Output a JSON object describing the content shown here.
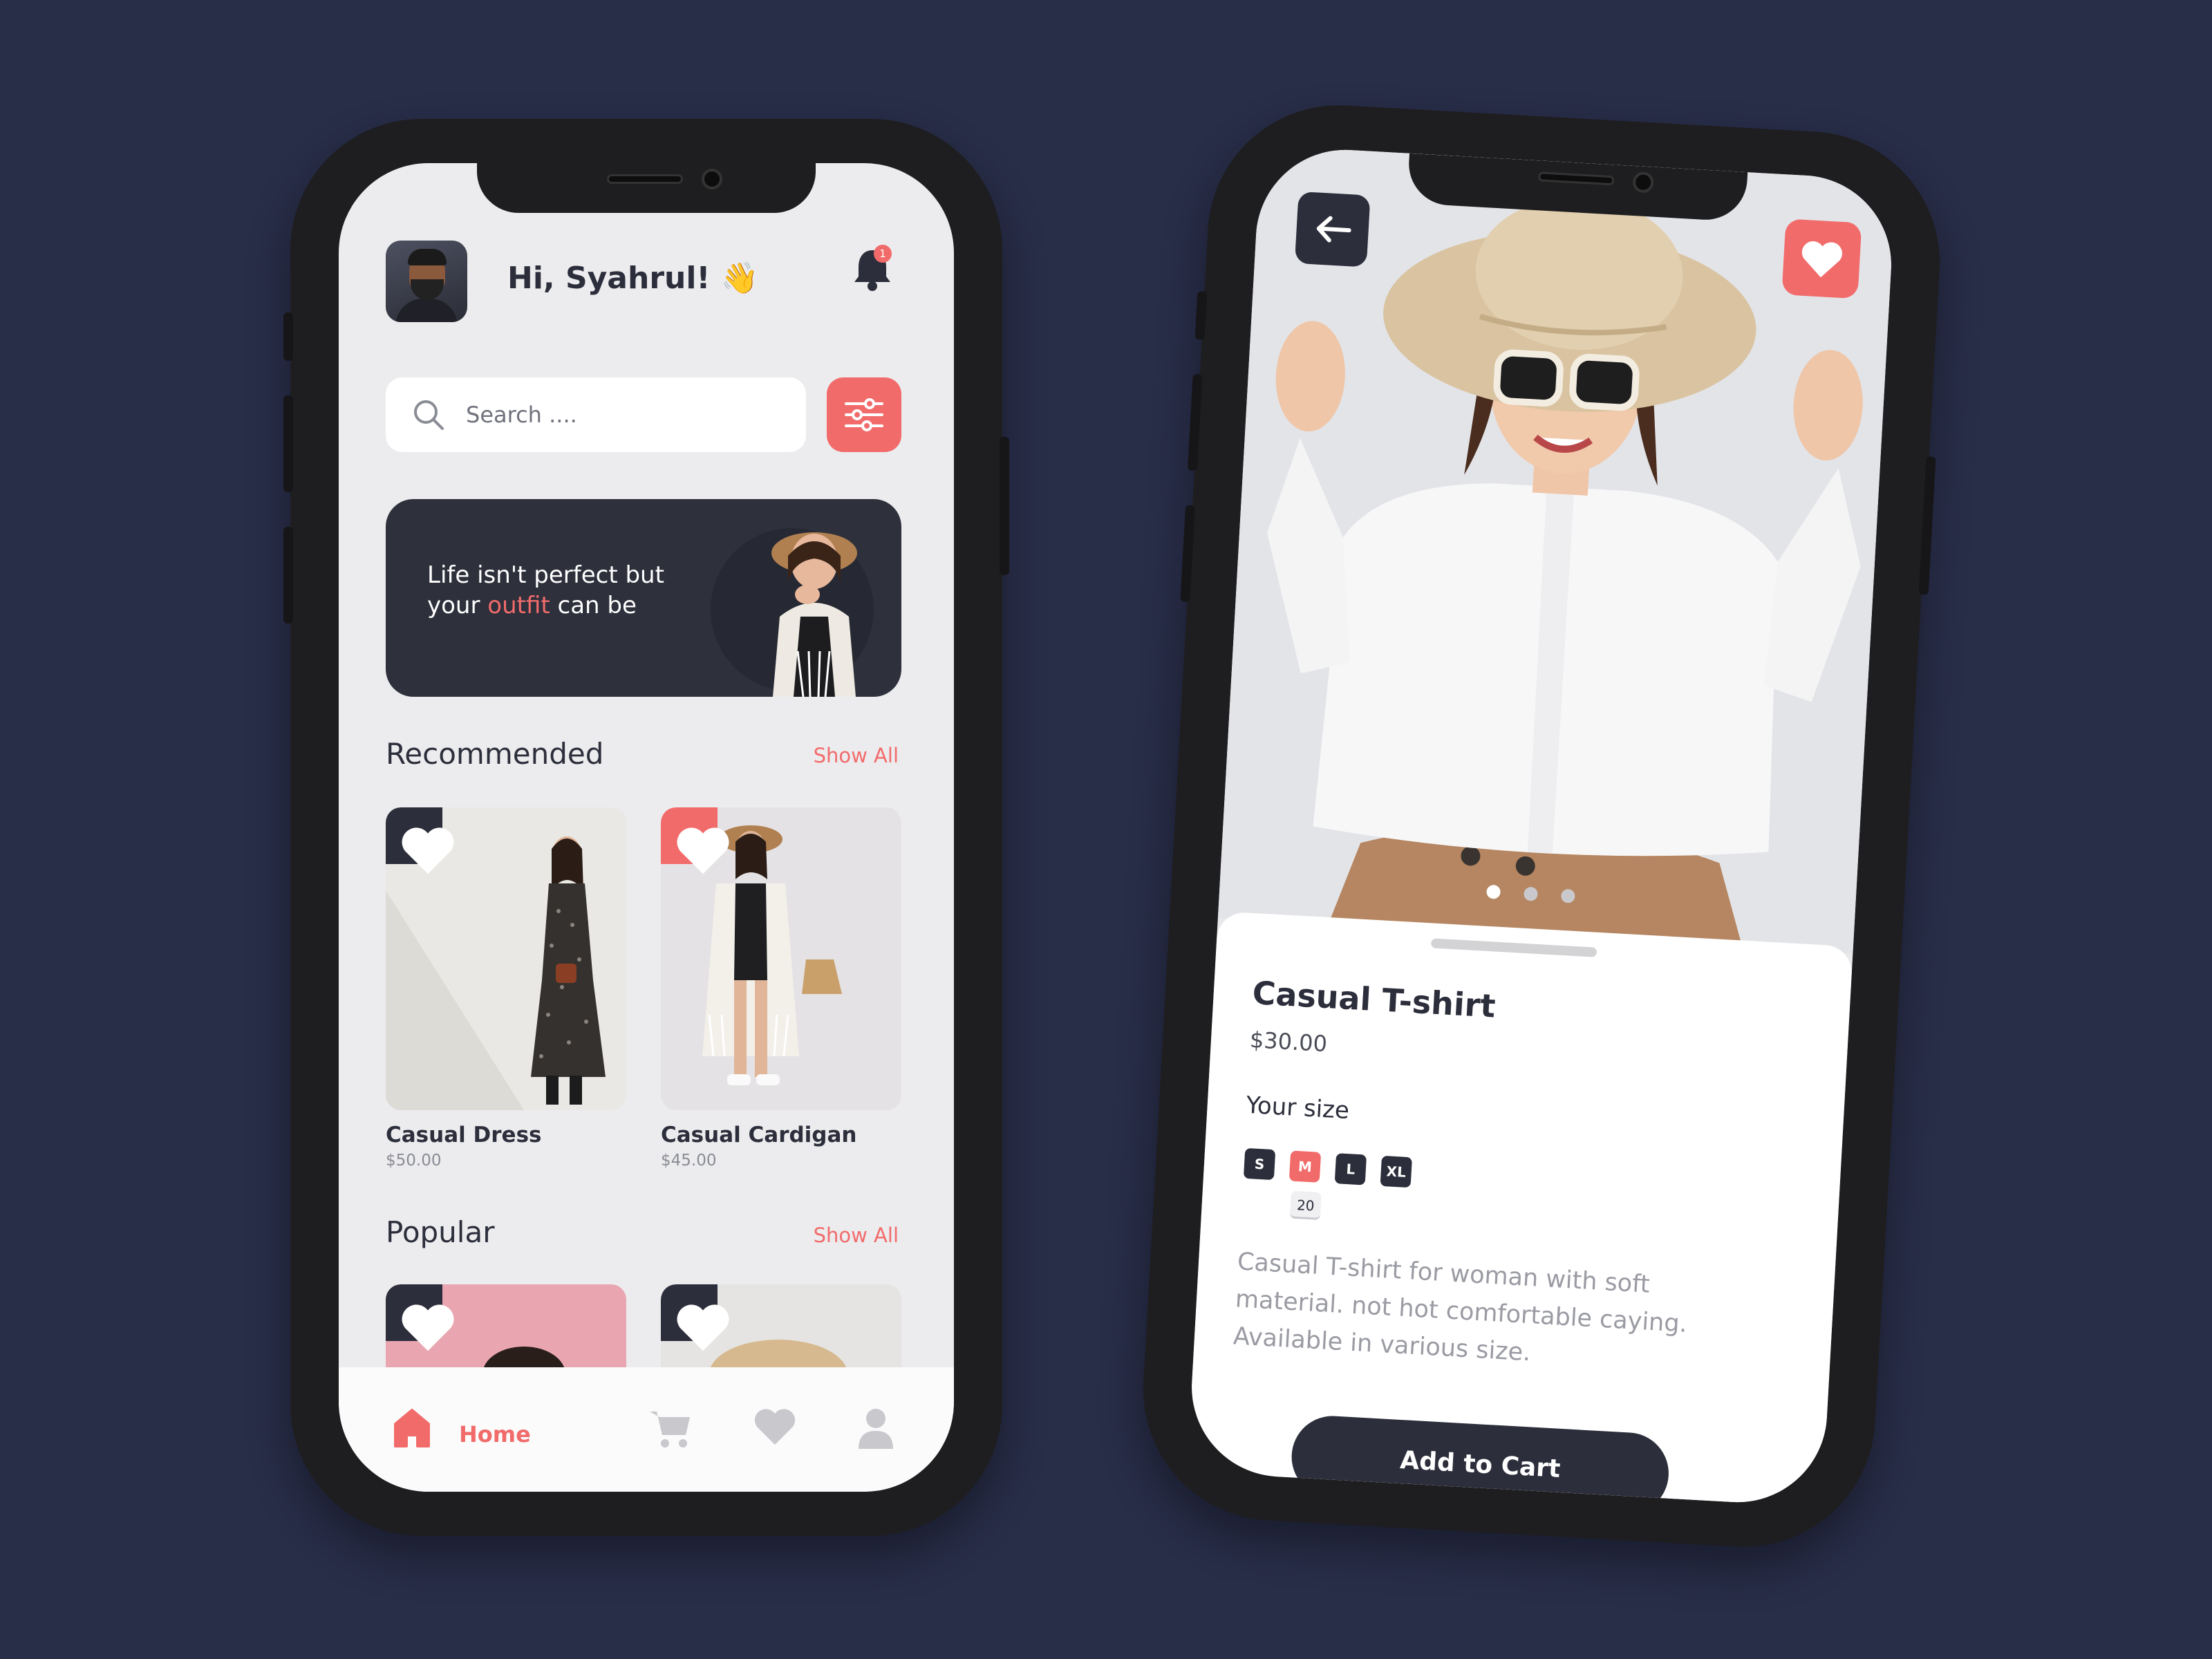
{
  "home": {
    "greeting": "Hi, Syahrul! 👋",
    "notification_count": "1",
    "search": {
      "placeholder": "Search ...."
    },
    "banner": {
      "line1": "Life isn't perfect but",
      "line2_prefix": "your ",
      "line2_accent": "outfit",
      "line2_suffix": " can be"
    },
    "recommended": {
      "title": "Recommended",
      "show_all": "Show All",
      "items": [
        {
          "name": "Casual Dress",
          "price": "$50.00",
          "favorited": false
        },
        {
          "name": "Casual  Cardigan",
          "price": "$45.00",
          "favorited": true
        }
      ]
    },
    "popular": {
      "title": "Popular",
      "show_all": "Show All"
    },
    "tabbar": {
      "active_label": "Home",
      "tabs": [
        "home-icon",
        "cart-icon",
        "heart-icon",
        "profile-icon"
      ]
    }
  },
  "detail": {
    "title": "Casual T-shirt",
    "price": "$30.00",
    "size_label": "Your size",
    "sizes": [
      "S",
      "M",
      "L",
      "XL"
    ],
    "selected_size": "M",
    "stock_count": "20",
    "description": "Casual T-shirt for woman with soft material. not hot comfortable caying. Available in various size.",
    "add_to_cart": "Add to Cart",
    "carousel_pages": 3,
    "carousel_active": 1
  },
  "colors": {
    "background": "#282d48",
    "accent": "#f26b6b",
    "dark": "#2c2e3b"
  }
}
